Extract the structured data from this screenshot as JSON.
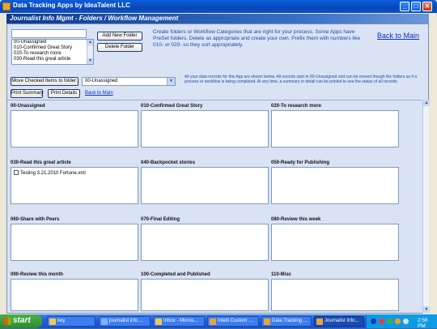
{
  "window": {
    "title": "Data Tracking Apps by IdeaTalent LLC",
    "minimize": "_",
    "maximize": "□",
    "close": "✕"
  },
  "subheader": "Journalist Info Mgmt - Folders / Workflow Management",
  "folder_editor": {
    "input_value": "",
    "list_items": [
      "00-Unassigned",
      "010-Confirmed Great Story",
      "020-To research more",
      "030-Read this great article"
    ],
    "add_button": "Add New Folder",
    "delete_button": "Delete Folder"
  },
  "instructions": "Create folders or Workflow Categories that are right for your process. Some Apps have PreSet folders. Delete as appropriate and create your own. Prefix them with numbers like 010- or 020- so they sort appropriately.",
  "back_to_main_top": "Back to Main",
  "move_bar": {
    "move_button": "Move Checked Items to folder:",
    "selected_folder": "00-Unassigned",
    "notice": "All your data records for this App are shown below. All records start in 00-Unassigned and can be moved though the folders as if a process or workflow is being completed. At any time, a summary or detail can be printed to see the status of all records.",
    "print_summary": "Print Summary",
    "print_details": "Print Details",
    "back_to_main": "Back to Main"
  },
  "folders": [
    {
      "name": "00-Unassigned",
      "records": []
    },
    {
      "name": "010-Confirmed Great Story",
      "records": []
    },
    {
      "name": "020-To research more",
      "records": []
    },
    {
      "name": "030-Read this great article",
      "records": [
        "Testing 3.21.2010 Fortune.xml"
      ]
    },
    {
      "name": "040-Backpocket stories",
      "records": []
    },
    {
      "name": "050-Ready for Publishing",
      "records": []
    },
    {
      "name": "060-Share with Peers",
      "records": []
    },
    {
      "name": "070-Final Editing",
      "records": []
    },
    {
      "name": "080-Review this week",
      "records": []
    },
    {
      "name": "090-Review this month",
      "records": []
    },
    {
      "name": "100-Completed and Published",
      "records": []
    },
    {
      "name": "110-Misc",
      "records": []
    }
  ],
  "taskbar": {
    "start": "start",
    "tasks": [
      {
        "label": "key",
        "icon": "folder-icon",
        "color": "#f2c94c"
      },
      {
        "label": "journalist info ...",
        "icon": "browser-icon",
        "color": "#7fb2f5"
      },
      {
        "label": "Inbox - Micros...",
        "icon": "mail-icon",
        "color": "#f2c94c"
      },
      {
        "label": "Intelli Custom ...",
        "icon": "app-icon",
        "color": "#e8a33a"
      },
      {
        "label": "Data Tracking ...",
        "icon": "app-icon",
        "color": "#e8a33a"
      },
      {
        "label": "Journalist Info...",
        "icon": "app-icon",
        "color": "#e8a33a"
      }
    ],
    "clock": "2:56 PM"
  }
}
